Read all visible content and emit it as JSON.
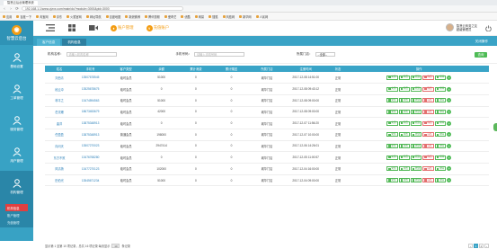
{
  "browser": {
    "tabs": [
      "智慧云后台管理系统"
    ],
    "url": "192.168.1.1/www.zjzxx.com/main/do?module=3000&pid=3000",
    "bookmarks": [
      "应用",
      "百度一下",
      "淘宝网",
      "京东",
      "火狐官网",
      "网址导航",
      "百度地图",
      "新浪微博",
      "腾讯视频",
      "爱奇艺",
      "优酷",
      "网易",
      "搜狐",
      "凤凰网",
      "新华网",
      "人民网"
    ]
  },
  "sidebar": {
    "logo": "智慧云后台",
    "items": [
      {
        "label": "基础设置",
        "icon": "person-icon"
      },
      {
        "label": "工单管理",
        "icon": "person-icon"
      },
      {
        "label": "服务管理",
        "icon": "person-icon"
      },
      {
        "label": "用户管理",
        "icon": "person-icon"
      },
      {
        "label": "机构管理",
        "icon": "person-icon"
      }
    ],
    "submenu": [
      "机构信息",
      "账户管理",
      "充值管理"
    ]
  },
  "topbar": {
    "menu1": "账户管理",
    "menu2": "充值账户",
    "user_name": "智慧云商务之友",
    "user_role": "超级管理员"
  },
  "page_tabs": {
    "tabs": [
      "客户信息",
      "机构信息"
    ],
    "active": 1,
    "close_all": "关闭操作"
  },
  "filters": {
    "name_label": "机构名称：",
    "name_placeholder": "请输入机构名称",
    "phone_label": "手机号码：",
    "phone_placeholder": "请输入手机号码",
    "status_label": "所属门店：",
    "status_value": "--全部--",
    "query_button": "查询"
  },
  "table": {
    "headers": [
      "姓名",
      "手机号",
      "客户类型",
      "余额",
      "累计消费",
      "累计赠送",
      "所属门店",
      "注册时间",
      "状态",
      "操作"
    ],
    "rows": [
      [
        "刘西青",
        "13507678545",
        "临时会员",
        "51000",
        "0",
        "0",
        "城华门店",
        "2017-12-08 14:51:00",
        "正常"
      ],
      [
        "段云冲",
        "13525678675",
        "临时会员",
        "0",
        "0",
        "0",
        "城华门店",
        "2017-12-08 09:43:12",
        "正常"
      ],
      [
        "林平之",
        "13474594563",
        "临时会员",
        "51000",
        "0",
        "0",
        "城华门店",
        "2017-12-08 09:00:00",
        "正常"
      ],
      [
        "岳灵珊",
        "18673453679",
        "临时会员",
        "42000",
        "0",
        "0",
        "城华门店",
        "2017-12-08 09:00:00",
        "正常"
      ],
      [
        "曲洋",
        "13875348913",
        "临时会员",
        "0",
        "0",
        "0",
        "城华门店",
        "2017-12-07 11:56:20",
        "正常"
      ],
      [
        "任盈盈",
        "13875348913",
        "普通会员",
        "198000",
        "0",
        "0",
        "城华门店",
        "2017-12-07 10:00:00",
        "正常"
      ],
      [
        "向问天",
        "13507270023",
        "临时会员",
        "2947414",
        "0",
        "0",
        "城华门店",
        "2017-12-06 14:26:01",
        "正常"
      ],
      [
        "东方不败",
        "13476768280",
        "临时会员",
        "0",
        "0",
        "0",
        "城华门店",
        "2017-12-05 11:00:57",
        "正常"
      ],
      [
        "风清扬",
        "13477270123",
        "临时会员",
        "102000",
        "0",
        "0",
        "城华门店",
        "2017-12-04 16:00:00",
        "正常"
      ],
      [
        "田伯光",
        "13545671234",
        "临时会员",
        "51000",
        "0",
        "0",
        "城华门店",
        "2017-12-04 09:00:00",
        "正常"
      ]
    ],
    "ops": [
      "充值",
      "消费",
      "赠送",
      "冻结",
      "详情"
    ]
  },
  "pager": {
    "summary": "显示第 1 至第 10 项记录，总共 16 项记录 每页显示",
    "page_size": "10",
    "suffix": "条记录",
    "prev": "‹",
    "pages": [
      "1",
      "2"
    ],
    "next": "›"
  },
  "colors": {
    "sidebar": "#38a2c4",
    "accent_orange": "#f39c12",
    "green": "#4dbb55",
    "header_blue": "#39a4c7"
  }
}
